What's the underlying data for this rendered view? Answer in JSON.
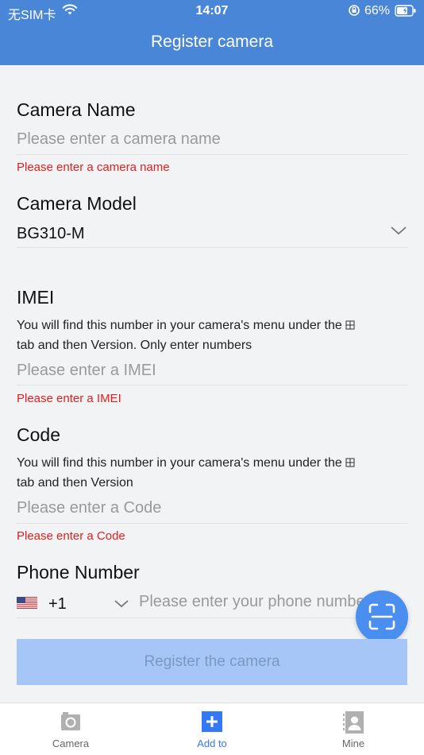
{
  "status_bar": {
    "carrier": "无SIM卡",
    "time": "14:07",
    "battery": "66%"
  },
  "header": {
    "title": "Register camera"
  },
  "form": {
    "camera_name": {
      "label": "Camera Name",
      "placeholder": "Please enter a camera name",
      "error": "Please enter a camera name"
    },
    "camera_model": {
      "label": "Camera Model",
      "value": "BG310-M"
    },
    "imei": {
      "label": "IMEI",
      "hint": "You will find this number in your camera's menu under the",
      "hint_end": "tab and then Version. Only enter numbers",
      "placeholder": "Please enter a IMEI",
      "error": "Please enter a IMEI"
    },
    "code": {
      "label": "Code",
      "hint": "You will find this number in your camera's menu under the",
      "hint_end": "tab and then Version",
      "placeholder": "Please enter a Code",
      "error": "Please enter a Code"
    },
    "phone": {
      "label": "Phone Number",
      "country_code": "+1",
      "placeholder": "Please enter your phone number"
    },
    "submit_label": "Register the camera"
  },
  "tabbar": {
    "items": [
      {
        "label": "Camera",
        "icon": "camera-icon",
        "active": false
      },
      {
        "label": "Add to",
        "icon": "add-icon",
        "active": true
      },
      {
        "label": "Mine",
        "icon": "profile-icon",
        "active": false
      }
    ]
  },
  "colors": {
    "primary": "#4a86d8",
    "accent": "#3478f6",
    "error": "#e02020",
    "button_disabled": "#a5c6f6",
    "background": "#f2f3f5"
  }
}
